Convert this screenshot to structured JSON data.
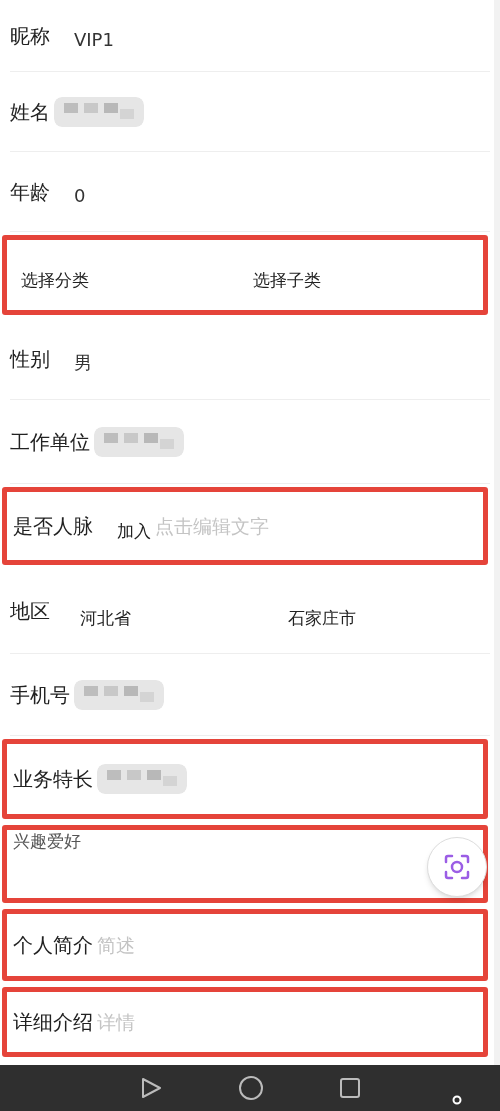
{
  "form": {
    "rows": [
      {
        "kind": "text",
        "label": "昵称",
        "value": "VIP1",
        "highlighted": false
      },
      {
        "kind": "blurred",
        "label": "姓名",
        "highlighted": false
      },
      {
        "kind": "text",
        "label": "年龄",
        "value": "0",
        "highlighted": false
      },
      {
        "kind": "options",
        "options": [
          "选择分类",
          "选择子类"
        ],
        "highlighted": true
      },
      {
        "kind": "text",
        "label": "性别",
        "value": "男",
        "highlighted": false
      },
      {
        "kind": "blurred",
        "label": "工作单位",
        "highlighted": false
      },
      {
        "kind": "input",
        "label": "是否人脉",
        "value": "加入",
        "placeholder": "点击编辑文字",
        "highlighted": true
      },
      {
        "kind": "labeled-options",
        "label": "地区",
        "options": [
          "河北省",
          "石家庄市"
        ],
        "highlighted": false
      },
      {
        "kind": "blurred",
        "label": "手机号",
        "highlighted": false
      },
      {
        "kind": "blurred",
        "label": "业务特长",
        "highlighted": true
      },
      {
        "kind": "textarea",
        "label": "兴趣爱好",
        "highlighted": true
      },
      {
        "kind": "input",
        "label": "个人简介",
        "placeholder": "简述",
        "highlighted": true
      },
      {
        "kind": "input",
        "label": "详细介绍",
        "placeholder": "详情",
        "highlighted": true
      }
    ]
  }
}
